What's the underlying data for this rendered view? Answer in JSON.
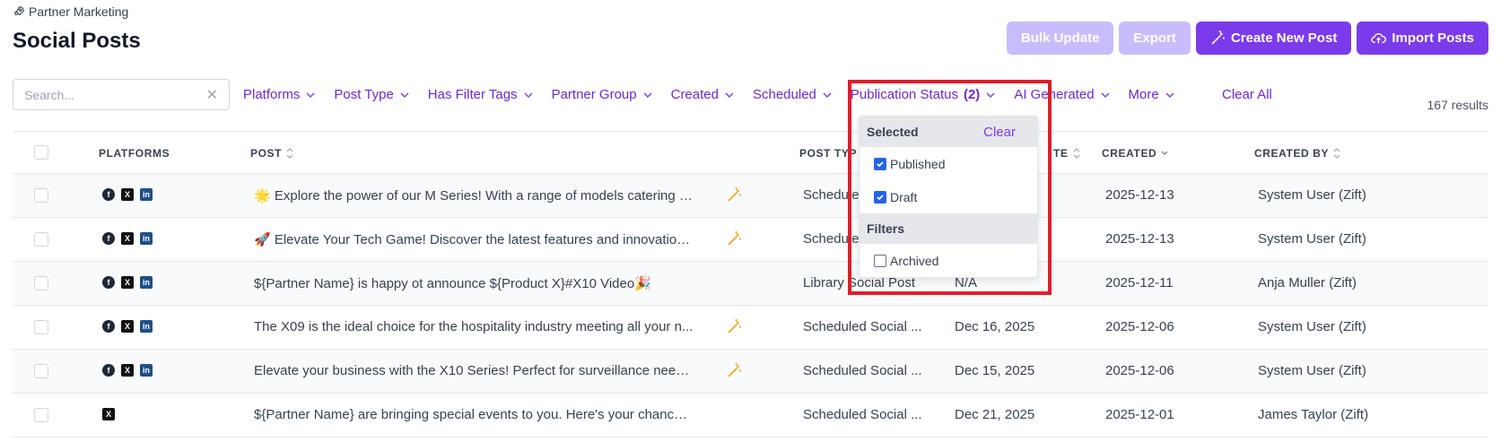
{
  "header": {
    "breadcrumb": "Partner Marketing",
    "title": "Social Posts"
  },
  "actions": {
    "bulk_update": "Bulk Update",
    "export": "Export",
    "create": "Create New Post",
    "import": "Import Posts"
  },
  "search": {
    "placeholder": "Search...",
    "value": ""
  },
  "filters": {
    "platforms": "Platforms",
    "post_type": "Post Type",
    "has_filter_tags": "Has Filter Tags",
    "partner_group": "Partner Group",
    "created": "Created",
    "scheduled": "Scheduled",
    "publication_status": "Publication Status",
    "publication_status_count": "(2)",
    "ai_generated": "AI Generated",
    "more": "More",
    "clear_all": "Clear All"
  },
  "results": "167 results",
  "columns": {
    "platforms": "PLATFORMS",
    "post": "POST",
    "post_type": "POST TYP",
    "scheduled": "TE",
    "created": "CREATED",
    "created_by": "CREATED BY"
  },
  "rows": [
    {
      "post": "🌟 Explore the power of our M Series! With a range of models catering t...",
      "ai": true,
      "platforms": [
        "facebook",
        "x",
        "linkedin"
      ],
      "post_type": "Schedule",
      "scheduled": "",
      "created": "2025-12-13",
      "created_by": "System User (Zift)"
    },
    {
      "post": "🚀 Elevate Your Tech Game! Discover the latest features and innovations...",
      "ai": true,
      "platforms": [
        "facebook",
        "x",
        "linkedin"
      ],
      "post_type": "Schedule",
      "scheduled": "",
      "created": "2025-12-13",
      "created_by": "System User (Zift)"
    },
    {
      "post": "${Partner Name} is happy ot announce ${Product X}#X10 Video🎉",
      "ai": false,
      "platforms": [
        "facebook",
        "x",
        "linkedin"
      ],
      "post_type": "Library Social Post",
      "scheduled": "N/A",
      "created": "2025-12-11",
      "created_by": "Anja Muller (Zift)"
    },
    {
      "post": "The X09 is the ideal choice for the hospitality industry meeting all your n...",
      "ai": true,
      "platforms": [
        "facebook",
        "x",
        "linkedin"
      ],
      "post_type": "Scheduled Social ...",
      "scheduled": "Dec 16, 2025",
      "created": "2025-12-06",
      "created_by": "System User (Zift)"
    },
    {
      "post": "Elevate your business with the X10 Series! Perfect for surveillance needs...",
      "ai": true,
      "platforms": [
        "facebook",
        "x",
        "linkedin"
      ],
      "post_type": "Scheduled Social ...",
      "scheduled": "Dec 15, 2025",
      "created": "2025-12-06",
      "created_by": "System User (Zift)"
    },
    {
      "post": "${Partner Name} are bringing special events to you. Here's your chance ...",
      "ai": false,
      "platforms": [
        "x"
      ],
      "post_type": "Scheduled Social ...",
      "scheduled": "Dec 21, 2025",
      "created": "2025-12-01",
      "created_by": "James Taylor (Zift)"
    }
  ],
  "dropdown": {
    "selected_header": "Selected",
    "clear": "Clear",
    "selected_items": [
      {
        "label": "Published",
        "checked": true
      },
      {
        "label": "Draft",
        "checked": true
      }
    ],
    "filters_header": "Filters",
    "filter_items": [
      {
        "label": "Archived",
        "checked": false
      }
    ]
  },
  "colors": {
    "accent": "#7c3aed",
    "accent_disabled": "#c4b5fd",
    "highlight": "#e11d2a",
    "checkbox_checked": "#2563eb"
  }
}
